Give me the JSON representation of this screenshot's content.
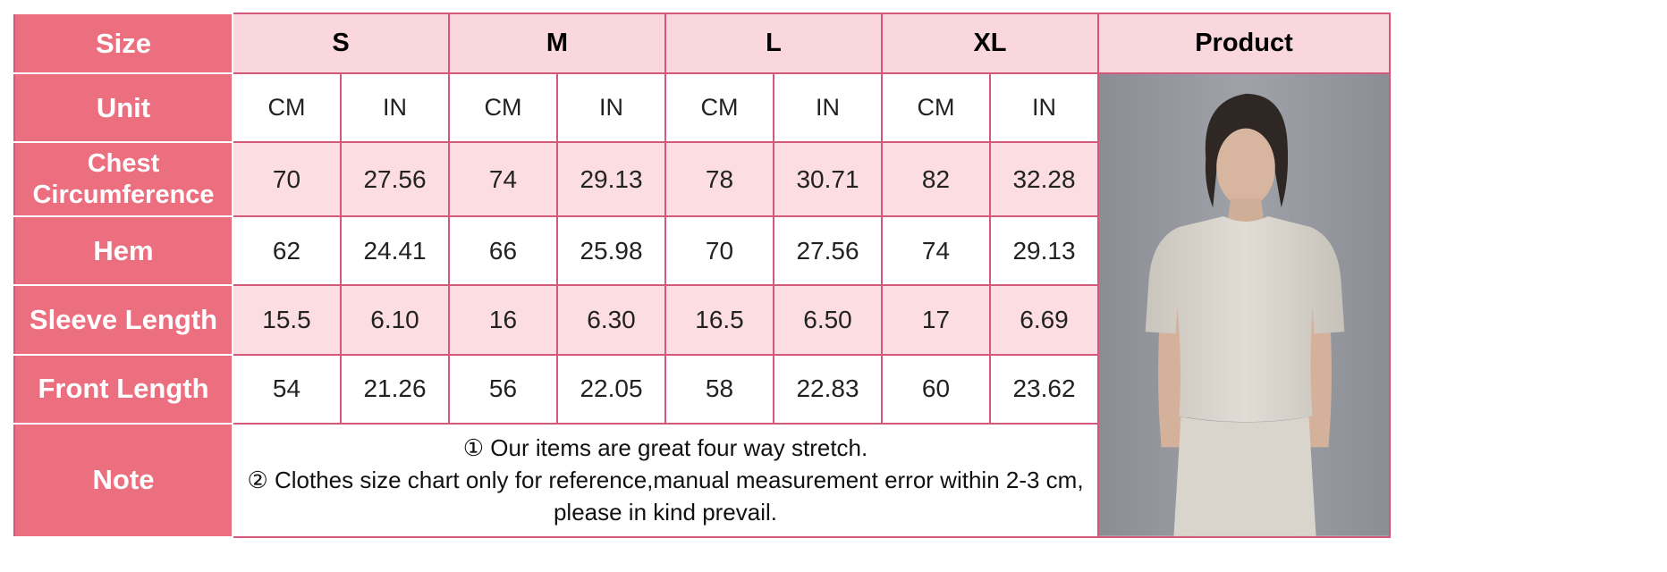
{
  "header": {
    "size_label": "Size",
    "sizes": [
      "S",
      "M",
      "L",
      "XL"
    ],
    "product_label": "Product"
  },
  "units": {
    "label": "Unit",
    "values": [
      "CM",
      "IN",
      "CM",
      "IN",
      "CM",
      "IN",
      "CM",
      "IN"
    ]
  },
  "rows": [
    {
      "label": "Chest\nCircumference",
      "values": [
        "70",
        "27.56",
        "74",
        "29.13",
        "78",
        "30.71",
        "82",
        "32.28"
      ]
    },
    {
      "label": "Hem",
      "values": [
        "62",
        "24.41",
        "66",
        "25.98",
        "70",
        "27.56",
        "74",
        "29.13"
      ]
    },
    {
      "label": "Sleeve Length",
      "values": [
        "15.5",
        "6.10",
        "16",
        "6.30",
        "16.5",
        "6.50",
        "17",
        "6.69"
      ]
    },
    {
      "label": "Front Length",
      "values": [
        "54",
        "21.26",
        "56",
        "22.05",
        "58",
        "22.83",
        "60",
        "23.62"
      ]
    }
  ],
  "note": {
    "label": "Note",
    "lines": [
      "① Our items are great four way stretch.",
      "② Clothes size chart only for reference,manual measurement error within 2-3 cm,",
      "please in kind prevail."
    ]
  },
  "colors": {
    "label_bg": "#ec6f80",
    "header_bg": "#fad7dd",
    "row_pink": "#fbdde2",
    "border": "#d4587a"
  }
}
